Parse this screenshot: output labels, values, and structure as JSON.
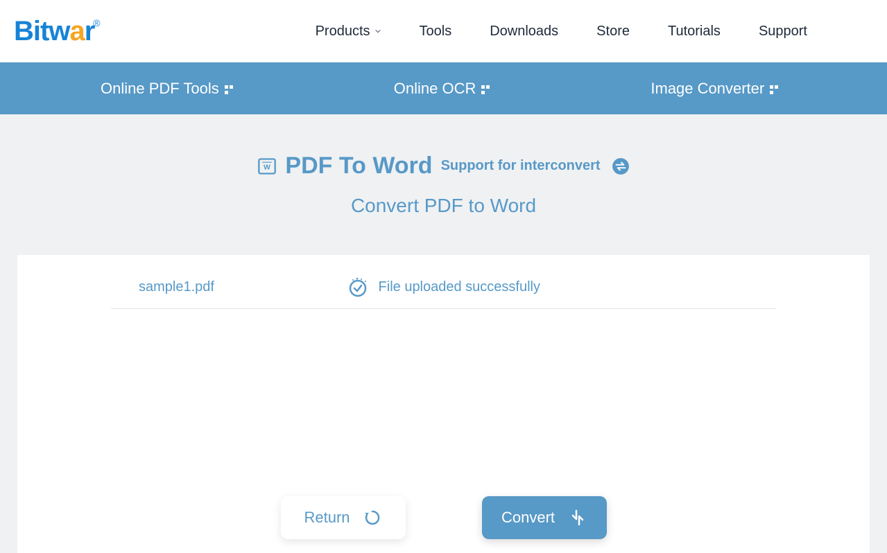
{
  "brand": {
    "name": "Bitwar"
  },
  "nav": {
    "products": "Products",
    "tools": "Tools",
    "downloads": "Downloads",
    "store": "Store",
    "tutorials": "Tutorials",
    "support": "Support"
  },
  "subnav": {
    "pdf_tools": "Online PDF Tools",
    "ocr": "Online OCR",
    "image_converter": "Image Converter"
  },
  "page": {
    "title": "PDF To Word",
    "support_text": "Support for interconvert",
    "subtitle": "Convert PDF to Word"
  },
  "upload": {
    "filename": "sample1.pdf",
    "status": "File uploaded successfully"
  },
  "actions": {
    "return": "Return",
    "convert": "Convert"
  }
}
